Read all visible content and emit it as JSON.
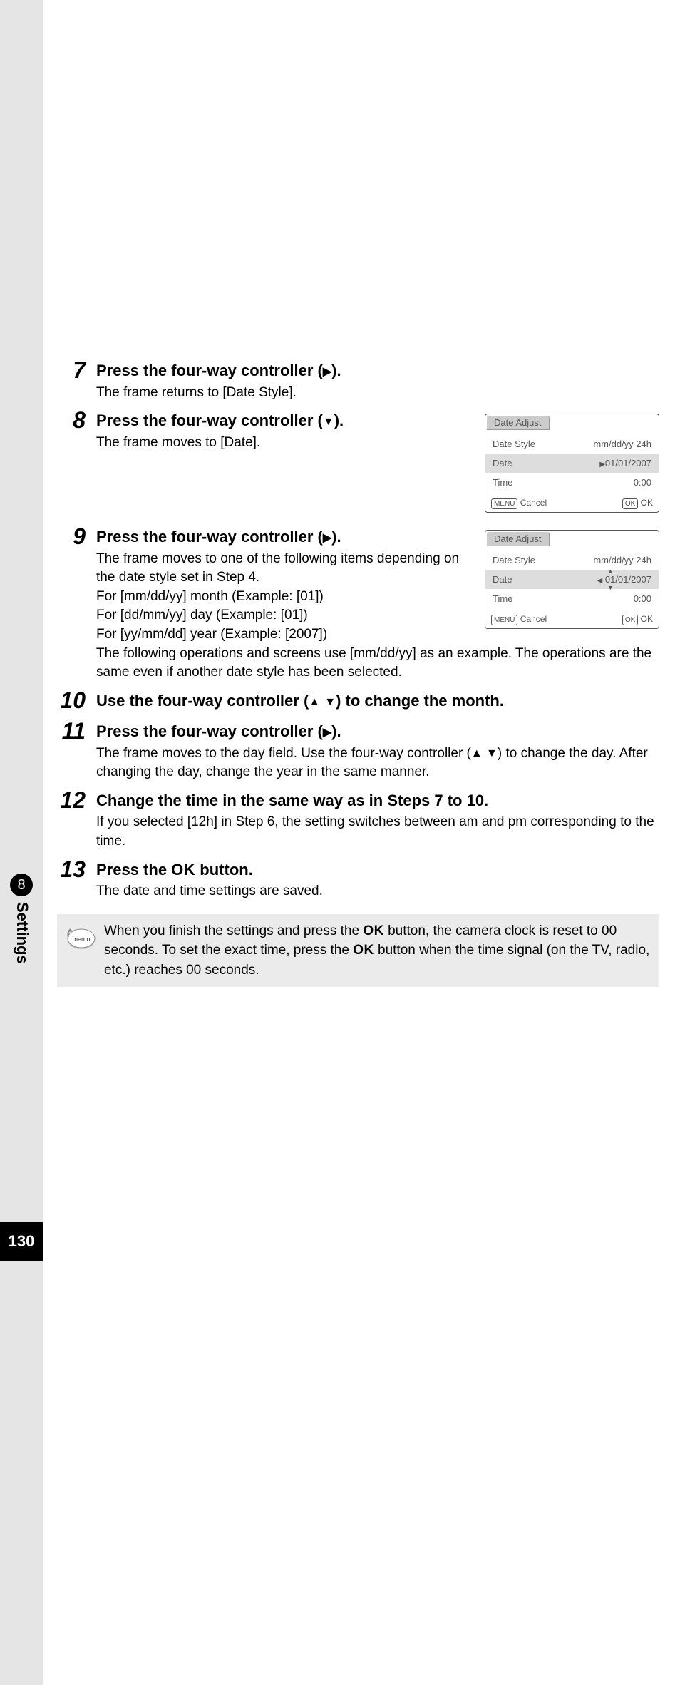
{
  "chapter": {
    "number": "8",
    "label": "Settings"
  },
  "page_number": "130",
  "lcd": {
    "title": "Date Adjust",
    "rows": {
      "style_label": "Date Style",
      "style_value": "mm/dd/yy  24h",
      "date_label": "Date",
      "date_value_a": "01/01/2007",
      "date_value_b": "01/01/2007",
      "time_label": "Time",
      "time_value": "0:00"
    },
    "footer": {
      "menu_btn": "MENU",
      "cancel": "Cancel",
      "ok_btn": "OK",
      "ok": "OK"
    }
  },
  "steps": {
    "s7": {
      "num": "7",
      "head_a": "Press the four-way controller (",
      "head_b": ").",
      "desc": "The frame returns to [Date Style]."
    },
    "s8": {
      "num": "8",
      "head_a": "Press the four-way controller (",
      "head_b": ").",
      "desc": "The frame moves to [Date]."
    },
    "s9": {
      "num": "9",
      "head_a": "Press the four-way controller (",
      "head_b": ").",
      "desc_a": "The frame moves to one of the following items depending on the date style set in Step 4.",
      "desc_b": "For [mm/dd/yy] month  (Example: [01])",
      "desc_c": "For [dd/mm/yy] day  (Example: [01])",
      "desc_d": "For [yy/mm/dd] year  (Example: [2007])",
      "desc_e": "The following operations and screens use [mm/dd/yy] as an example. The operations are the same even if another date style has been selected."
    },
    "s10": {
      "num": "10",
      "head_a": "Use the four-way controller (",
      "head_b": ") to change the month."
    },
    "s11": {
      "num": "11",
      "head_a": "Press the four-way controller (",
      "head_b": ").",
      "desc_a": "The frame moves to the day field. Use the four-way controller (",
      "desc_b": ") to change the day. After changing the day, change the year in the same manner."
    },
    "s12": {
      "num": "12",
      "head": "Change the time in the same way as in Steps 7 to 10.",
      "desc": "If you selected [12h] in Step 6, the setting switches between am and pm corresponding to the time."
    },
    "s13": {
      "num": "13",
      "head_a": "Press the ",
      "head_b": " button.",
      "ok": "OK",
      "desc": "The date and time settings are saved."
    }
  },
  "memo": {
    "label": "memo",
    "text_a": "When you finish the settings and press the ",
    "text_b": " button, the camera clock is reset to 00 seconds. To set the exact time, press the ",
    "text_c": " button when the time signal (on the TV, radio, etc.) reaches 00 seconds.",
    "ok": "OK"
  }
}
